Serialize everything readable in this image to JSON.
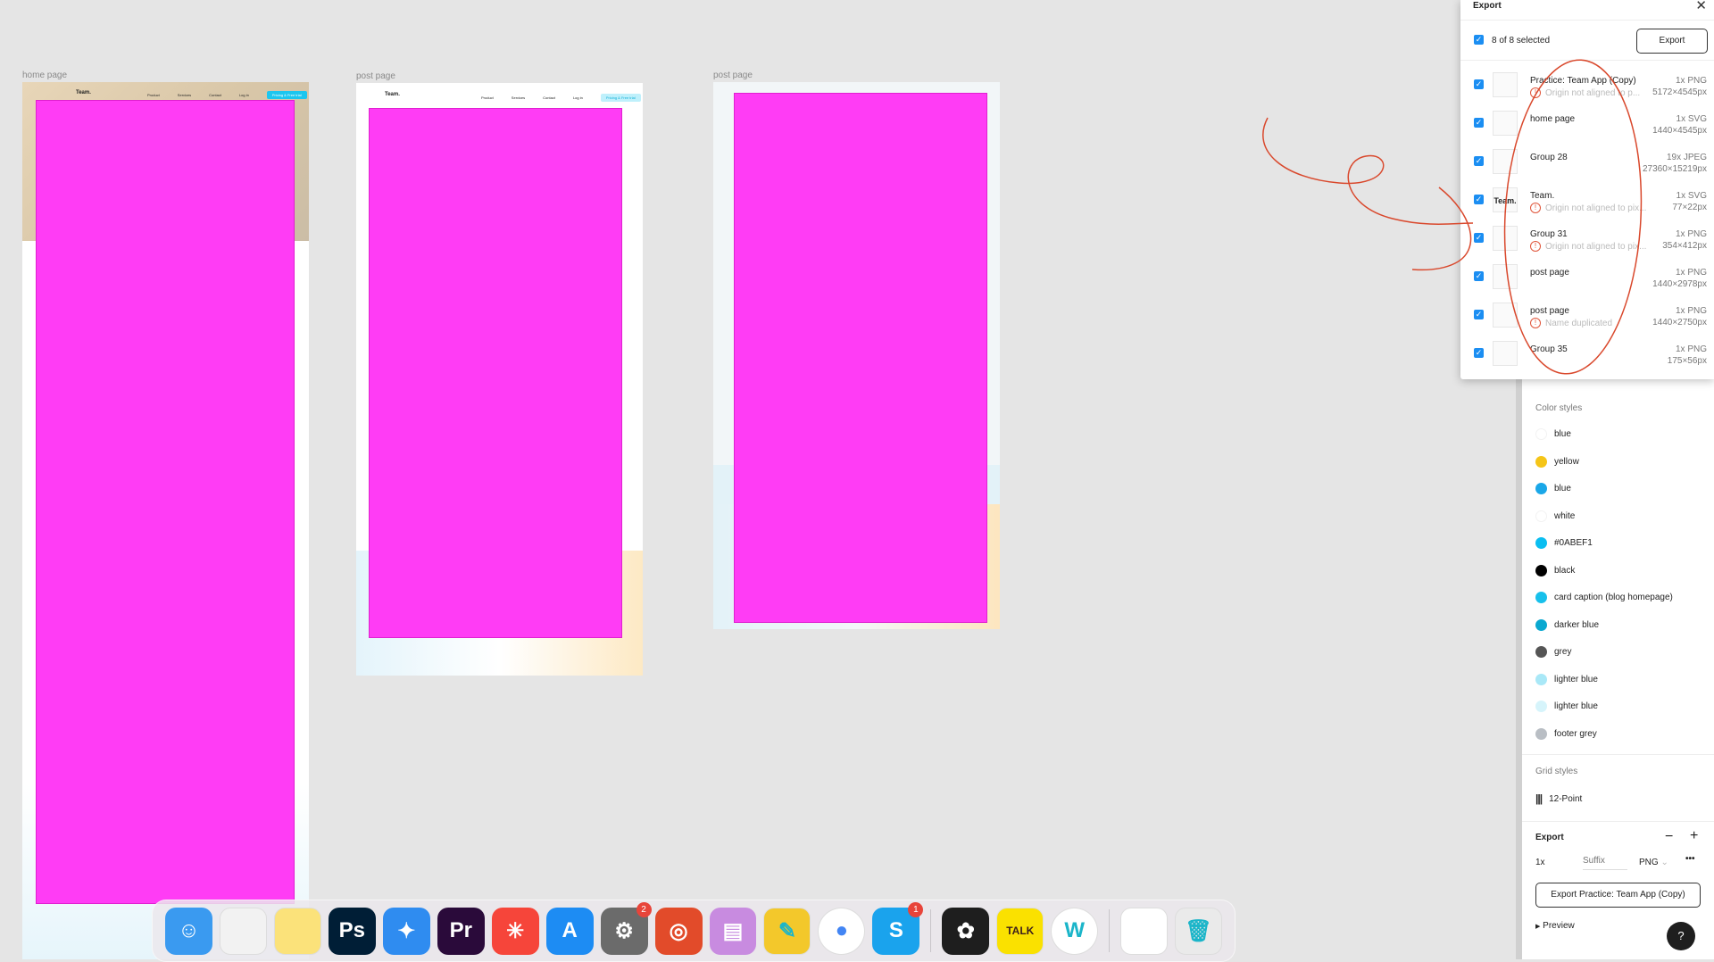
{
  "canvas": {
    "frames": [
      {
        "label": "home page",
        "nav": {
          "logo": "Team.",
          "links": [
            "Product",
            "Services",
            "Contact",
            "Log in"
          ],
          "cta": "Pricing & Free trial"
        }
      },
      {
        "label": "post page",
        "nav": {
          "logo": "Team.",
          "links": [
            "Product",
            "Services",
            "Contact",
            "Log in"
          ],
          "cta": "Pricing & Free trial"
        }
      },
      {
        "label": "post page"
      }
    ],
    "placeholder_color": "#ff3cf5"
  },
  "export_dialog": {
    "title": "Export",
    "selected_text": "8 of 8 selected",
    "export_label": "Export",
    "items": [
      {
        "name": "Practice: Team App (Copy)",
        "format": "1x PNG",
        "size": "5172×4545px",
        "warning": "Origin not aligned to p..."
      },
      {
        "name": "home page",
        "format": "1x SVG",
        "size": "1440×4545px",
        "warning": ""
      },
      {
        "name": "Group 28",
        "format": "19x JPEG",
        "size": "27360×15219px",
        "warning": ""
      },
      {
        "name": "Team.",
        "format": "1x SVG",
        "size": "77×22px",
        "warning": "Origin not aligned to pix...",
        "thumb_text": "Team."
      },
      {
        "name": "Group 31",
        "format": "1x PNG",
        "size": "354×412px",
        "warning": "Origin not aligned to pix..."
      },
      {
        "name": "post page",
        "format": "1x PNG",
        "size": "1440×2978px",
        "warning": ""
      },
      {
        "name": "post page",
        "format": "1x PNG",
        "size": "1440×2750px",
        "warning": "Name duplicated"
      },
      {
        "name": "Group 35",
        "format": "1x PNG",
        "size": "175×56px",
        "warning": ""
      }
    ]
  },
  "right_panel": {
    "color_styles_title": "Color styles",
    "color_styles": [
      {
        "name": "blue",
        "color": "#ffffff"
      },
      {
        "name": "yellow",
        "color": "#f5c518"
      },
      {
        "name": "blue",
        "color": "#1aa7e8"
      },
      {
        "name": "white",
        "color": "#ffffff"
      },
      {
        "name": "#0ABEF1",
        "color": "#0abef1"
      },
      {
        "name": "black",
        "color": "#000000"
      },
      {
        "name": "card caption (blog homepage)",
        "color": "#17c0eb"
      },
      {
        "name": "darker blue",
        "color": "#0aa8d0"
      },
      {
        "name": "grey",
        "color": "#555555"
      },
      {
        "name": "lighter blue",
        "color": "#a9e8f7"
      },
      {
        "name": "lighter blue",
        "color": "#d6f4fb"
      },
      {
        "name": "footer grey",
        "color": "#b9bec4"
      }
    ],
    "grid_styles_title": "Grid styles",
    "grid_style": "12-Point",
    "export": {
      "title": "Export",
      "scale": "1x",
      "suffix_placeholder": "Suffix",
      "format": "PNG",
      "button": "Export Practice: Team App (Copy)",
      "preview": "Preview"
    },
    "help": "?"
  },
  "dock": {
    "apps": [
      {
        "name": "finder",
        "color": "#3a9af0",
        "glyph": "☺"
      },
      {
        "name": "launchpad",
        "color": "#f2f2f2",
        "glyph": ""
      },
      {
        "name": "notes",
        "color": "#fbe27a",
        "glyph": ""
      },
      {
        "name": "photoshop",
        "color": "#001e36",
        "glyph": "Ps"
      },
      {
        "name": "safari",
        "color": "#2f8cf0",
        "glyph": "✦"
      },
      {
        "name": "premiere",
        "color": "#2a0a3a",
        "glyph": "Pr"
      },
      {
        "name": "clock",
        "color": "#f6453a",
        "glyph": "✳"
      },
      {
        "name": "app-store",
        "color": "#1d8cf3",
        "glyph": "A"
      },
      {
        "name": "system-preferences",
        "color": "#6b6b6b",
        "glyph": "⚙",
        "badge": "2"
      },
      {
        "name": "instruments",
        "color": "#e24b2a",
        "glyph": "◎"
      },
      {
        "name": "screenshot-app",
        "color": "#c88be0",
        "glyph": "▤"
      },
      {
        "name": "measure",
        "color": "#f3c82b",
        "glyph": "✎"
      },
      {
        "name": "chrome",
        "color": "#ffffff",
        "glyph": "●"
      },
      {
        "name": "skype",
        "color": "#1aa3ed",
        "glyph": "S",
        "badge": "1"
      },
      {
        "name": "figma",
        "color": "#1e1e1e",
        "glyph": "✿"
      },
      {
        "name": "kakaotalk",
        "color": "#fae100",
        "glyph": "TALK"
      },
      {
        "name": "w-app",
        "color": "#ffffff",
        "glyph": "W"
      },
      {
        "name": "downloads-stack",
        "color": "#ffffff",
        "glyph": ""
      },
      {
        "name": "trash",
        "color": "#eaeaea",
        "glyph": "🗑"
      }
    ]
  }
}
